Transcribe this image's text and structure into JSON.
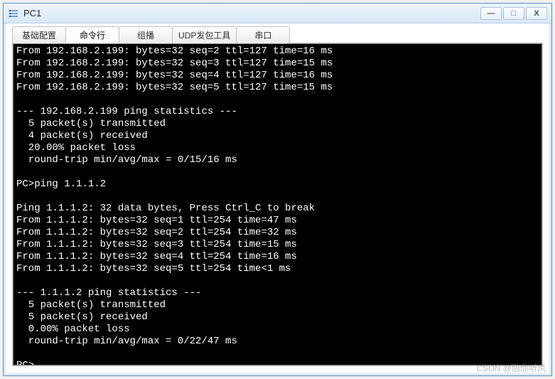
{
  "window": {
    "title": "PC1"
  },
  "tabs": [
    {
      "label": "基础配置",
      "active": false
    },
    {
      "label": "命令行",
      "active": true
    },
    {
      "label": "组播",
      "active": false
    },
    {
      "label": "UDP发包工具",
      "active": false
    },
    {
      "label": "串口",
      "active": false
    }
  ],
  "terminal": {
    "lines": [
      "From 192.168.2.199: bytes=32 seq=2 ttl=127 time=16 ms",
      "From 192.168.2.199: bytes=32 seq=3 ttl=127 time=15 ms",
      "From 192.168.2.199: bytes=32 seq=4 ttl=127 time=16 ms",
      "From 192.168.2.199: bytes=32 seq=5 ttl=127 time=15 ms",
      "",
      "--- 192.168.2.199 ping statistics ---",
      "  5 packet(s) transmitted",
      "  4 packet(s) received",
      "  20.00% packet loss",
      "  round-trip min/avg/max = 0/15/16 ms",
      "",
      "PC>ping 1.1.1.2",
      "",
      "Ping 1.1.1.2: 32 data bytes, Press Ctrl_C to break",
      "From 1.1.1.2: bytes=32 seq=1 ttl=254 time=47 ms",
      "From 1.1.1.2: bytes=32 seq=2 ttl=254 time=32 ms",
      "From 1.1.1.2: bytes=32 seq=3 ttl=254 time=15 ms",
      "From 1.1.1.2: bytes=32 seq=4 ttl=254 time=16 ms",
      "From 1.1.1.2: bytes=32 seq=5 ttl=254 time<1 ms",
      "",
      "--- 1.1.1.2 ping statistics ---",
      "  5 packet(s) transmitted",
      "  5 packet(s) received",
      "  0.00% packet loss",
      "  round-trip min/avg/max = 0/22/47 ms",
      "",
      "PC>"
    ]
  },
  "watermark": "CSDN @陪你听风",
  "win_controls": {
    "min": "—",
    "max": "□",
    "close": "X"
  }
}
